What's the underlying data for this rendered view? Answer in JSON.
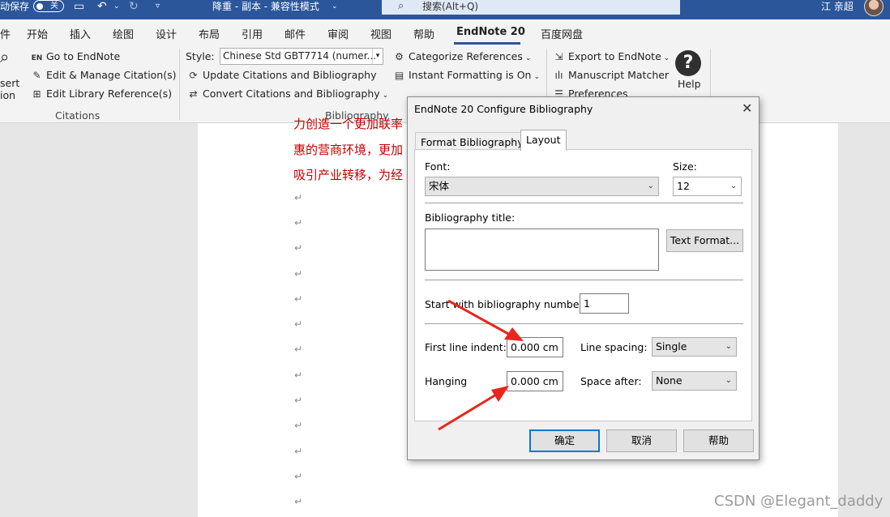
{
  "titlebar": {
    "autosave_label": "动保存",
    "autosave_state": "关",
    "doc_title": "降重 - 副本  -  兼容性模式",
    "search_placeholder": "搜索(Alt+Q)",
    "user_name": "江 亲超"
  },
  "menu": {
    "file_fragment": "件",
    "items": [
      "开始",
      "插入",
      "绘图",
      "设计",
      "布局",
      "引用",
      "邮件",
      "审阅",
      "视图",
      "帮助",
      "EndNote 20",
      "百度网盘"
    ],
    "active": "EndNote 20"
  },
  "ribbon": {
    "insert_fragment_1": "sert",
    "insert_fragment_2": "ion",
    "go_to_endnote": "Go to EndNote",
    "edit_manage": "Edit & Manage Citation(s)",
    "edit_library": "Edit Library Reference(s)",
    "citations_group": "Citations",
    "style_label": "Style:",
    "style_value": "Chinese Std GBT7714 (numer...",
    "update_citations": "Update Citations and Bibliography",
    "convert_citations": "Convert Citations and Bibliography",
    "bibliography_group": "Bibliography",
    "categorize": "Categorize References",
    "instant_formatting": "Instant Formatting is On",
    "export": "Export to EndNote",
    "manuscript": "Manuscript Matcher",
    "preferences": "Preferences",
    "help": "Help",
    "en_badge": "EN"
  },
  "document": {
    "lines": [
      "力创造一个更加联率",
      "惠的营商环境，更加",
      "吸引产业转移，为经"
    ],
    "para_mark": "↵"
  },
  "dialog": {
    "title": "EndNote 20 Configure Bibliography",
    "tabs": [
      "Format Bibliography",
      "Layout"
    ],
    "active_tab": "Layout",
    "font_label": "Font:",
    "font_value": "宋体",
    "size_label": "Size:",
    "size_value": "12",
    "bib_title_label": "Bibliography title:",
    "bib_title_value": "",
    "text_format_button": "Text Format...",
    "start_number_label": "Start with bibliography number:",
    "start_number_value": "1",
    "first_line_indent_label": "First line indent:",
    "first_line_indent_value": "0.000 cm",
    "hanging_label": "Hanging",
    "hanging_value": "0.000 cm",
    "line_spacing_label": "Line spacing:",
    "line_spacing_value": "Single",
    "space_after_label": "Space after:",
    "space_after_value": "None",
    "ok_button": "确定",
    "cancel_button": "取消",
    "help_button": "帮助"
  },
  "watermark": "CSDN @Elegant_daddy",
  "colors": {
    "titlebar": "#2b579a",
    "ribbon": "#f3f3f3",
    "doc_text": "#c00000",
    "annotation_arrow": "#e8261c",
    "ok_border": "#0078d7"
  }
}
